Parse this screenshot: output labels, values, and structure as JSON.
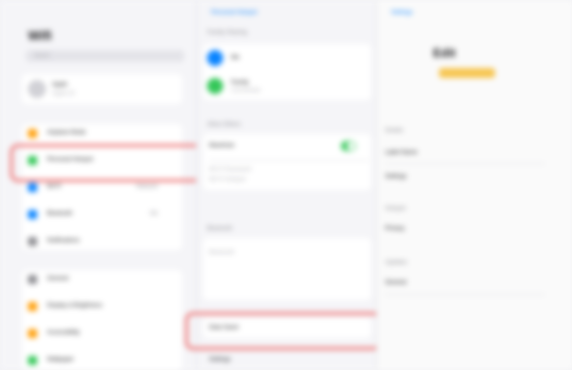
{
  "sidebar": {
    "title": "Wifi",
    "search_placeholder": "Search",
    "account": {
      "name": "Apple",
      "subtitle": "Apple ID"
    },
    "items": [
      {
        "label": "Airplane Mode",
        "value": "",
        "color": "#ff9f0a"
      },
      {
        "label": "Personal Hotspot",
        "value": "",
        "color": "#34c759"
      },
      {
        "label": "Wi-Fi",
        "value": "Network",
        "color": "#0a84ff"
      },
      {
        "label": "Bluetooth",
        "value": "On",
        "color": "#0a84ff"
      },
      {
        "label": "Notifications",
        "value": "",
        "color": "#8e8e93"
      },
      {
        "label": "General",
        "value": "",
        "color": "#8e8e93"
      },
      {
        "label": "Display & Brightness",
        "value": "",
        "color": "#ff9f0a"
      },
      {
        "label": "Accessibility",
        "value": "",
        "color": "#ff9f0a"
      },
      {
        "label": "Wallpaper",
        "value": "",
        "color": "#34c759"
      }
    ]
  },
  "middle": {
    "back_label": "Personal Hotspot",
    "family_label": "Family Sharing",
    "members": [
      {
        "name": "Me",
        "color": "#0a84ff"
      },
      {
        "name": "Family",
        "sub": "Connected",
        "color": "#34c759"
      }
    ],
    "section_label": "Allow Others",
    "toggle_label": "Maximize",
    "wifi_label": "Wi-Fi Password",
    "wifi_hint": "Wi-Fi Hotspot",
    "bluetooth_label": "Bluetooth",
    "bluetooth_hint": "Bluetooth",
    "highlighted_row": "Data Saver",
    "footer": "Settings"
  },
  "right": {
    "back_label": "Settings",
    "device_label": "Edit",
    "rows": [
      "Details",
      "Label Name",
      "Settings",
      "Hotspot",
      "Privacy",
      "Updates",
      "General"
    ]
  },
  "colors": {
    "highlight": "#ee7b7b"
  }
}
